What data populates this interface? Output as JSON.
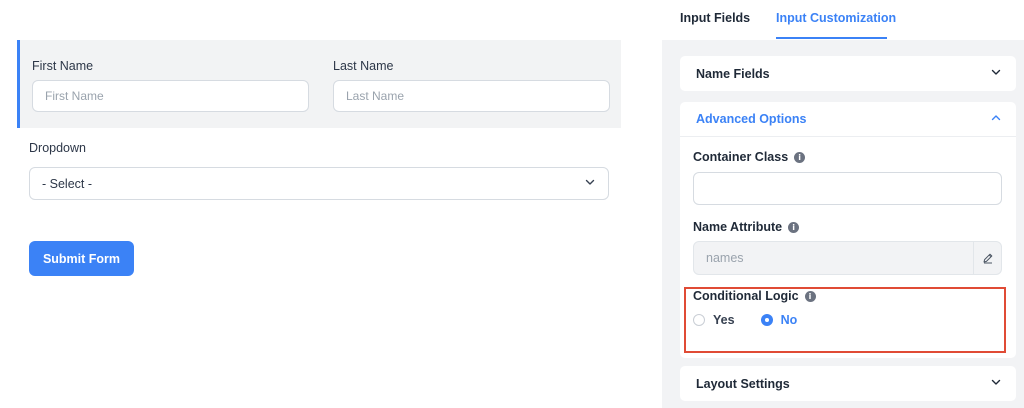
{
  "form": {
    "first_name": {
      "label": "First Name",
      "placeholder": "First Name",
      "value": ""
    },
    "last_name": {
      "label": "Last Name",
      "placeholder": "Last Name",
      "value": ""
    },
    "dropdown": {
      "label": "Dropdown",
      "selected": "- Select -"
    },
    "submit_label": "Submit Form"
  },
  "panel": {
    "tabs": [
      {
        "label": "Input Fields",
        "active": false
      },
      {
        "label": "Input Customization",
        "active": true
      }
    ],
    "sections": {
      "name_fields": "Name Fields",
      "advanced_options": "Advanced Options",
      "layout_settings": "Layout Settings"
    },
    "advanced": {
      "container_class": {
        "label": "Container Class",
        "value": ""
      },
      "name_attribute": {
        "label": "Name Attribute",
        "value": "names"
      },
      "conditional_logic": {
        "label": "Conditional Logic",
        "options": [
          "Yes",
          "No"
        ],
        "selected": "No"
      }
    }
  },
  "icons": {
    "info": "info-icon",
    "chevron_down": "chevron-down-icon",
    "chevron_up": "chevron-up-icon",
    "edit": "pencil-icon"
  },
  "colors": {
    "accent": "#3b82f6",
    "highlight": "#e04b35"
  }
}
